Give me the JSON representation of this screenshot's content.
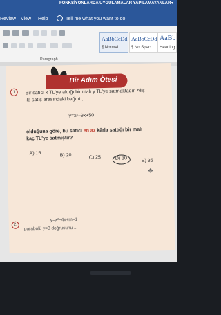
{
  "window": {
    "title": "FONKSİYONLARDA UYGULAMALAR YAPILAMAYANLAR"
  },
  "menu": {
    "items": [
      "Review",
      "View",
      "Help"
    ],
    "tell_me": "Tell me what you want to do"
  },
  "ribbon": {
    "group_label": "Paragraph",
    "styles": [
      {
        "sample": "AaBbCcDd",
        "name": "¶ Normal"
      },
      {
        "sample": "AaBbCcDd",
        "name": "¶ No Spac..."
      },
      {
        "sample": "AaBb",
        "name": "Heading"
      }
    ]
  },
  "document": {
    "banner": "Bir Adım Ötesi",
    "question1": {
      "number": "1",
      "line1": "Bir satıcı x TL'ye aldığı bir malı y TL'ye satmaktadır. Alış",
      "line2": "ile satış arasındaki bağıntı;",
      "equation": "y=x²–9x+50",
      "line3": "olduğuna göre, bu satıcı en az kârla sattığı bir malı",
      "line4": "kaç TL'ye satmıştır?",
      "highlight": "en az",
      "options": [
        "A) 15",
        "B) 20",
        "C) 25",
        "D) 30",
        "E) 35"
      ]
    },
    "question2": {
      "number": "2.",
      "equation": "y=x²–4x+m–1",
      "line1": "parabolü y=3 doğrusunu ..."
    }
  }
}
